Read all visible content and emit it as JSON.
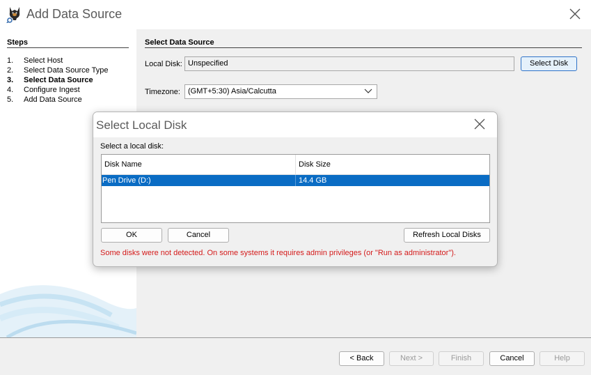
{
  "window": {
    "title": "Add Data Source",
    "icon": "autopsy-dog-icon",
    "close_icon": "close-icon"
  },
  "steps": {
    "heading": "Steps",
    "current_index": 2,
    "items": [
      {
        "num": "1.",
        "label": "Select Host"
      },
      {
        "num": "2.",
        "label": "Select Data Source Type"
      },
      {
        "num": "3.",
        "label": "Select Data Source"
      },
      {
        "num": "4.",
        "label": "Configure Ingest"
      },
      {
        "num": "5.",
        "label": "Add Data Source"
      }
    ]
  },
  "main": {
    "section_title": "Select Data Source",
    "local_disk_label": "Local Disk:",
    "local_disk_value": "Unspecified",
    "select_disk_button": "Select Disk",
    "timezone_label": "Timezone:",
    "timezone_value": "(GMT+5:30) Asia/Calcutta"
  },
  "dialog": {
    "title": "Select Local Disk",
    "prompt": "Select a local disk:",
    "columns": [
      "Disk Name",
      "Disk Size"
    ],
    "rows": [
      {
        "name": "Pen Drive (D:)",
        "size": "14.4 GB",
        "selected": true
      }
    ],
    "ok_button": "OK",
    "cancel_button": "Cancel",
    "refresh_button": "Refresh Local Disks",
    "warning": "Some disks were not detected. On some systems it requires admin privileges (or \"Run as administrator\")."
  },
  "footer": {
    "back": "< Back",
    "next": "Next >",
    "finish": "Finish",
    "cancel": "Cancel",
    "help": "Help"
  },
  "colors": {
    "selection": "#0a6cc4",
    "warning": "#d41a1a",
    "accent_border": "#2f73c8"
  }
}
